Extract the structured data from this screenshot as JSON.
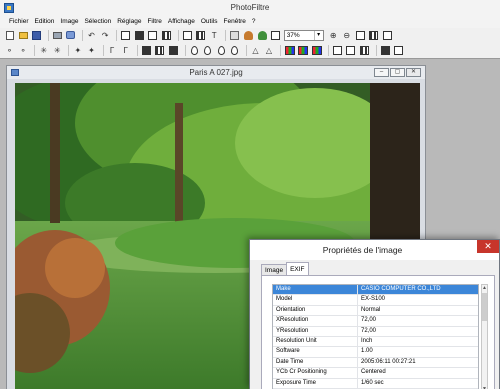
{
  "app": {
    "title": "PhotoFiltre"
  },
  "menu": {
    "items": [
      "Fichier",
      "Edition",
      "Image",
      "Sélection",
      "Réglage",
      "Filtre",
      "Affichage",
      "Outils",
      "Fenêtre",
      "?"
    ]
  },
  "toolbar": {
    "zoom_value": "37%",
    "text_tool_label": "T"
  },
  "document": {
    "title": "Paris A 027.jpg"
  },
  "dialog": {
    "title": "Propriétés de l'image",
    "tabs": [
      "Image",
      "EXIF"
    ],
    "active_tab": "EXIF",
    "rows": [
      {
        "key": "Make",
        "value": "CASIO COMPUTER CO.,LTD"
      },
      {
        "key": "Model",
        "value": "EX-S100"
      },
      {
        "key": "Orientation",
        "value": "Normal"
      },
      {
        "key": "XResolution",
        "value": "72,00"
      },
      {
        "key": "YResolution",
        "value": "72,00"
      },
      {
        "key": "Resolution Unit",
        "value": "Inch"
      },
      {
        "key": "Software",
        "value": "1.00"
      },
      {
        "key": "Date Time",
        "value": "2005:06:11 00:27:21"
      },
      {
        "key": "YCb Cr Positioning",
        "value": "Centered"
      },
      {
        "key": "Exposure Time",
        "value": "1/60 sec"
      }
    ]
  },
  "colors": {
    "selection": "#3c86d8",
    "close_button": "#c7352b"
  }
}
